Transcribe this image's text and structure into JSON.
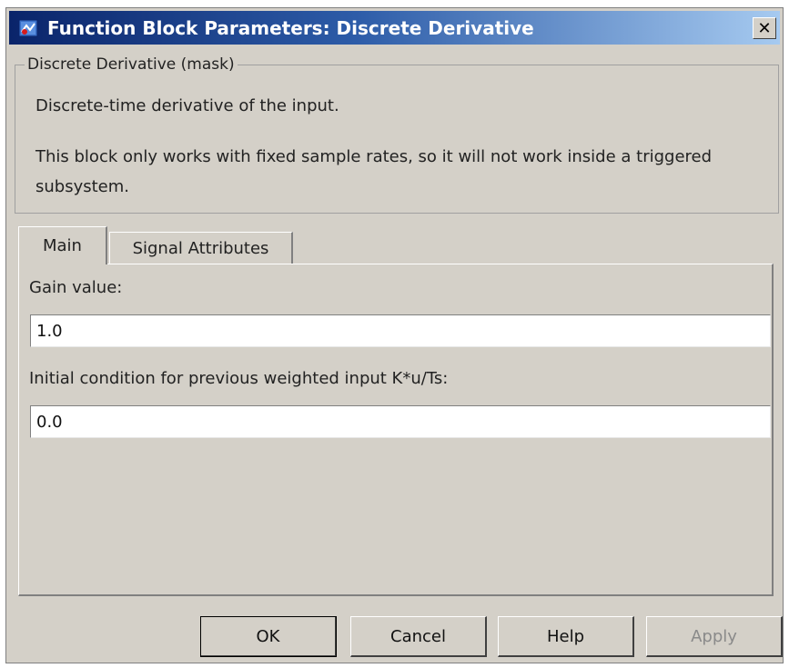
{
  "window": {
    "title": "Function Block Parameters: Discrete Derivative",
    "close_label": "✕"
  },
  "mask": {
    "legend": "Discrete Derivative (mask)",
    "description_line1": "Discrete-time derivative of the input.",
    "description_line2": "This block only works with fixed sample rates, so it will not work inside a triggered",
    "description_line3": "subsystem."
  },
  "tabs": [
    {
      "label": "Main",
      "selected": true
    },
    {
      "label": "Signal Attributes",
      "selected": false
    }
  ],
  "main": {
    "gain_label": "Gain value:",
    "gain_value": "1.0",
    "initial_condition_label": "Initial condition for previous weighted input K*u/Ts:",
    "initial_condition_value": "0.0"
  },
  "buttons": {
    "ok": "OK",
    "cancel": "Cancel",
    "help": "Help",
    "apply": "Apply",
    "apply_enabled": false
  },
  "icons": {
    "app": "simulink-block-icon",
    "close": "close-icon"
  }
}
